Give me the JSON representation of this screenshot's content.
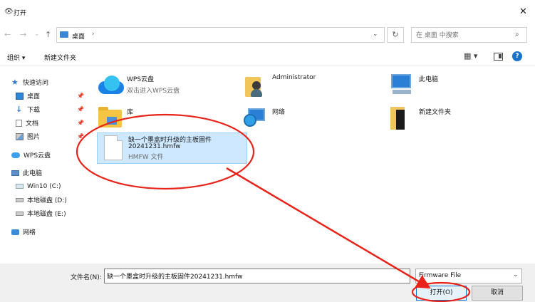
{
  "window": {
    "title": "打开",
    "close_glyph": "✕"
  },
  "nav": {
    "back": "←",
    "forward": "→",
    "recent": "⌄",
    "up": "↑",
    "breadcrumb": "桌面",
    "breadcrumb_sep": "›",
    "dropdown": "⌄",
    "refresh": "↻",
    "search_placeholder": "在 桌面 中搜索",
    "search_glyph": "⌕"
  },
  "toolbar": {
    "organize": "组织 ▾",
    "new_folder": "新建文件夹",
    "view_glyph": "▦ ▾",
    "help_glyph": "?"
  },
  "sidebar": {
    "pin_glyph": "📌",
    "items": [
      {
        "label": "快速访问"
      },
      {
        "label": "桌面"
      },
      {
        "label": "下载"
      },
      {
        "label": "文档"
      },
      {
        "label": "图片"
      },
      {
        "label": "WPS云盘"
      },
      {
        "label": "此电脑"
      },
      {
        "label": "Win10 (C:)"
      },
      {
        "label": "本地磁盘 (D:)"
      },
      {
        "label": "本地磁盘 (E:)"
      },
      {
        "label": "网络"
      }
    ]
  },
  "files": {
    "wps": {
      "name": "WPS云盘",
      "sub": "双击进入WPS云盘"
    },
    "admin": {
      "name": "Administrator"
    },
    "thispc": {
      "name": "此电脑"
    },
    "library": {
      "name": "库"
    },
    "network": {
      "name": "网络"
    },
    "newfolder": {
      "name": "新建文件夹"
    },
    "selected": {
      "name_line1": "缺一个墨盒时升级的主板固件",
      "name_line2": "20241231.hmfw",
      "type": "HMFW 文件"
    }
  },
  "bottom": {
    "filename_label": "文件名(N):",
    "filename_value": "缺一个墨盒时升级的主板固件20241231.hmfw",
    "filetype": "Firmware File",
    "filetype_chev": "⌄",
    "open": "打开(O)",
    "cancel": "取消"
  },
  "colors": {
    "annotation": "#e8231a",
    "selection": "#cde8ff",
    "accent": "#0078d7"
  }
}
